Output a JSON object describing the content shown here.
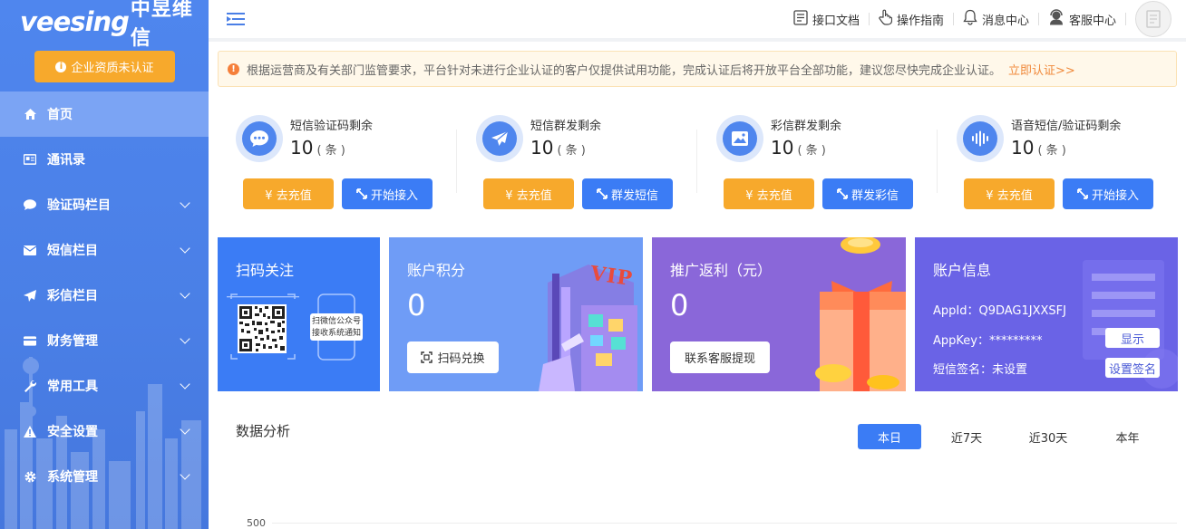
{
  "brand": {
    "en": "veesing",
    "cn": "中昱维信"
  },
  "sidebar": {
    "cert_button": "企业资质未认证",
    "items": [
      {
        "label": "首页",
        "icon": "home-icon"
      },
      {
        "label": "通讯录",
        "icon": "contacts-icon"
      },
      {
        "label": "验证码栏目",
        "icon": "chat-icon"
      },
      {
        "label": "短信栏目",
        "icon": "envelope-icon"
      },
      {
        "label": "彩信栏目",
        "icon": "paper-plane-icon"
      },
      {
        "label": "财务管理",
        "icon": "credit-card-icon"
      },
      {
        "label": "常用工具",
        "icon": "wrench-icon"
      },
      {
        "label": "安全设置",
        "icon": "warning-icon"
      },
      {
        "label": "系统管理",
        "icon": "gear-icon"
      }
    ]
  },
  "header": {
    "links": [
      {
        "label": "接口文档",
        "icon": "document-icon"
      },
      {
        "label": "操作指南",
        "icon": "hand-pointer-icon"
      },
      {
        "label": "消息中心",
        "icon": "bell-icon"
      },
      {
        "label": "客服中心",
        "icon": "support-agent-icon"
      }
    ]
  },
  "notice": {
    "text": "根据运营商及有关部门监管要求，平台针对未进行企业认证的客户仅提供试用功能，完成认证后将开放平台全部功能，建议您尽快完成企业认证。",
    "link": "立即认证>>"
  },
  "stats": [
    {
      "title": "短信验证码剩余",
      "value": "10",
      "unit": "( 条 )",
      "recharge": "¥ 去充值",
      "action": "开始接入",
      "icon": "chat-bubble-icon"
    },
    {
      "title": "短信群发剩余",
      "value": "10",
      "unit": "( 条 )",
      "recharge": "¥ 去充值",
      "action": "群发短信",
      "icon": "send-icon"
    },
    {
      "title": "彩信群发剩余",
      "value": "10",
      "unit": "( 条 )",
      "recharge": "¥ 去充值",
      "action": "群发彩信",
      "icon": "image-icon"
    },
    {
      "title": "语音短信/验证码剩余",
      "value": "10",
      "unit": "( 条 )",
      "recharge": "¥ 去充值",
      "action": "开始接入",
      "icon": "voice-wave-icon"
    }
  ],
  "cards": {
    "qr": {
      "title": "扫码关注",
      "phone_text_1": "扫微信公众号",
      "phone_text_2": "接收系统通知"
    },
    "points": {
      "title": "账户积分",
      "value": "0",
      "button": "扫码兑换",
      "vip": "VIP"
    },
    "rebate": {
      "title": "推广返利（元）",
      "value": "0",
      "button": "联系客服提现"
    },
    "account": {
      "title": "账户信息",
      "appid_label": "AppId：",
      "appid": "Q9DAG1JXXSFJ",
      "appkey_label": "AppKey：",
      "appkey": "*********",
      "sign_label": "短信签名：",
      "sign": "未设置",
      "show_button": "显示",
      "set_sign_button": "设置签名"
    }
  },
  "analysis": {
    "title": "数据分析",
    "ranges": [
      "本日",
      "近7天",
      "近30天",
      "本年"
    ],
    "active_range": "本日",
    "y_tick": "500"
  },
  "colors": {
    "primary": "#3b7cf5",
    "orange": "#f7a92c",
    "sidebar": "#4a7fe6",
    "purple": "#8a67d9",
    "indigo": "#6a63e6"
  }
}
